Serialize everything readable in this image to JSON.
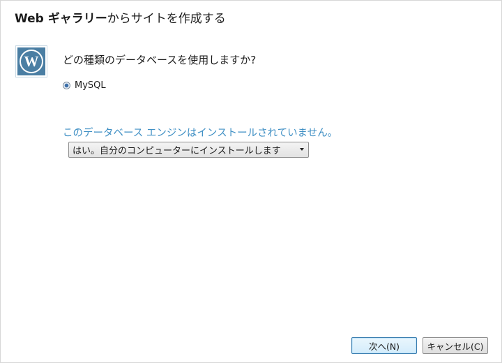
{
  "window": {
    "title_bold": "Web ギャラリー",
    "title_rest": "からサイトを作成する"
  },
  "icons": {
    "app_logo": "wordpress-logo-icon"
  },
  "database": {
    "question": "どの種類のデータベースを使用しますか?",
    "options": [
      {
        "label": "MySQL",
        "selected": true
      }
    ]
  },
  "engine": {
    "status_text": "このデータベース エンジンはインストールされていません。",
    "install_select_value": "はい。自分のコンピューターにインストールします"
  },
  "buttons": {
    "next": "次へ(N)",
    "cancel": "キャンセル(C)"
  },
  "colors": {
    "accent": "#3f8fc4",
    "logo": "#4a7ea3"
  }
}
